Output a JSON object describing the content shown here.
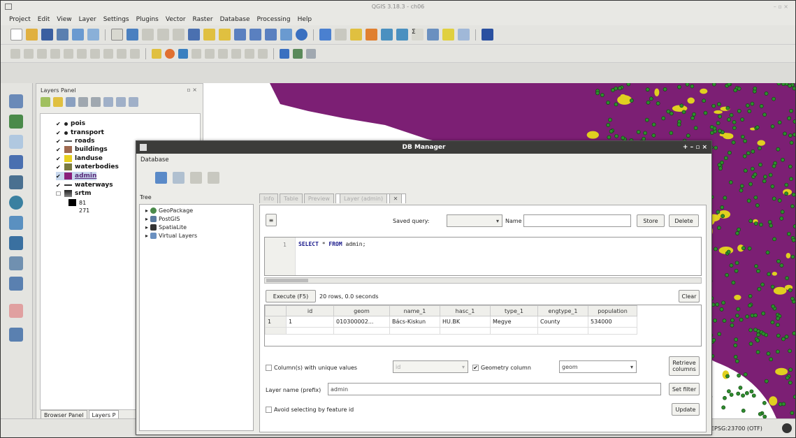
{
  "window": {
    "title": "QGIS 3.18.3 - ch06"
  },
  "menubar": [
    "Project",
    "Edit",
    "View",
    "Layer",
    "Settings",
    "Plugins",
    "Vector",
    "Raster",
    "Database",
    "Processing",
    "Help"
  ],
  "layers_panel": {
    "title": "Layers Panel",
    "layers": [
      {
        "name": "pois",
        "checked": true,
        "symbol": "point",
        "color": "#222222"
      },
      {
        "name": "transport",
        "checked": true,
        "symbol": "point",
        "color": "#222222"
      },
      {
        "name": "roads",
        "checked": true,
        "symbol": "line",
        "color": "#555555"
      },
      {
        "name": "buildings",
        "checked": true,
        "symbol": "fill",
        "color": "#a06a50"
      },
      {
        "name": "landuse",
        "checked": true,
        "symbol": "fill",
        "color": "#e8d020"
      },
      {
        "name": "waterbodies",
        "checked": true,
        "symbol": "fill",
        "color": "#7a7a40"
      },
      {
        "name": "admin",
        "checked": true,
        "symbol": "fill",
        "color": "#8a1f7a",
        "selected": true
      },
      {
        "name": "waterways",
        "checked": true,
        "symbol": "line",
        "color": "#333333"
      },
      {
        "name": "srtm",
        "checked": false,
        "symbol": "raster",
        "color": "#333333"
      }
    ],
    "srtm_legend": [
      "81",
      "271"
    ],
    "tabs": [
      "Browser Panel",
      "Layers P"
    ]
  },
  "db_manager": {
    "title": "DB Manager",
    "menu": "Database",
    "tree_label": "Tree",
    "tree_items": [
      "GeoPackage",
      "PostGIS",
      "SpatiaLite",
      "Virtual Layers"
    ],
    "tabs": [
      "Info",
      "Table",
      "Preview",
      "Layer (admin)"
    ],
    "active_tab": "Layer (admin)",
    "saved_query_label": "Saved query:",
    "name_label": "Name",
    "store_label": "Store",
    "delete_label": "Delete",
    "sql_line_number": "1",
    "sql": {
      "kw1": "SELECT",
      "star": "*",
      "kw2": "FROM",
      "table": "admin;"
    },
    "execute_label": "Execute (F5)",
    "result_text": "20 rows, 0.0 seconds",
    "clear_label": "Clear",
    "columns": [
      "id",
      "geom",
      "name_1",
      "hasc_1",
      "type_1",
      "engtype_1",
      "population"
    ],
    "rows": [
      {
        "n": "1",
        "id": "1",
        "geom": "010300002...",
        "name_1": "Bács-Kiskun",
        "hasc_1": "HU.BK",
        "type_1": "Megye",
        "engtype_1": "County",
        "population": "534000"
      }
    ],
    "unique_label": "Column(s) with unique values",
    "unique_value": "id",
    "geometry_label": "Geometry column",
    "geometry_value": "geom",
    "retrieve_label": "Retrieve columns",
    "layer_name_label": "Layer name (prefix)",
    "layer_name_value": "admin",
    "set_filter_label": "Set filter",
    "avoid_label": "Avoid selecting by feature id",
    "update_label": "Update"
  },
  "statusbar": {
    "crs": "EPSG:23700 (OTF)"
  },
  "colors": {
    "map_fill": "#7c1f74",
    "map_points": "#2e8c2e",
    "map_landuse": "#e0d020"
  }
}
